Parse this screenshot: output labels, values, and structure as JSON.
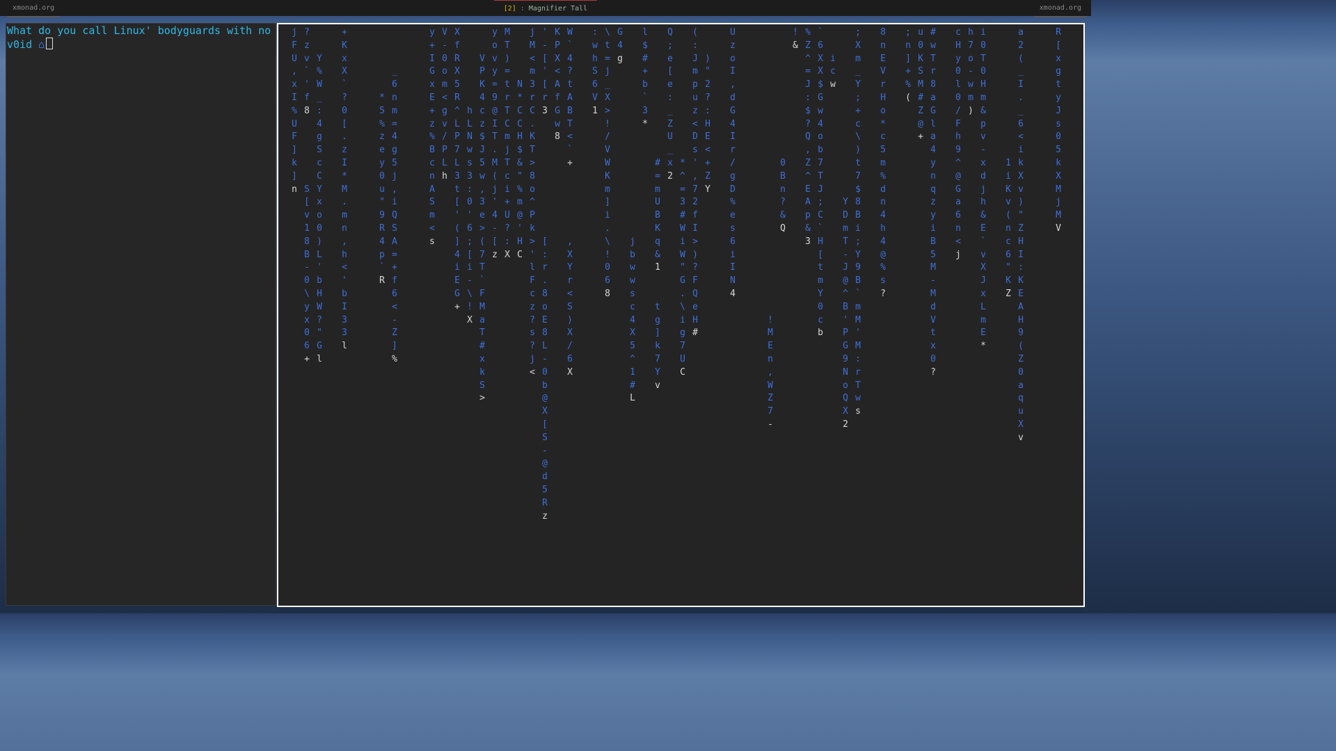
{
  "statusbar": {
    "left_title": "xmonad.org",
    "workspace": "[2]",
    "separator": " : ",
    "layout": "Magnifier Tall",
    "right_title": "xmonad.org"
  },
  "terminal": {
    "text": "What do you call Linux' bodyguards with no v0id ",
    "prompt_icon": "⌂"
  },
  "matrix": {
    "columns": [
      {
        "chars": "jFU,xI%UF]k]n"
      },
      {
        "chars": "?zv`'f8"
      },
      {
        "chars": "S[v18B-0\\yx06+"
      },
      {
        "chars": "Y%W_:4gScCYxo0)L'bHW?\"Gl"
      },
      {
        "chars": "+KxX`?0[.zI*M.mn,h<'bI33l"
      },
      {
        "chars": "_6nm=4g5j,iQSA=+f6<-Z]%"
      },
      {
        "chars": "*5%zey0u\"9R4p`R"
      },
      {
        "chars": "y+IGxE+z%BcnASm<s"
      },
      {
        "chars": "V-0om<gv/PLh"
      },
      {
        "chars": "XfRX5R^LP7L3t['(]4iEG+"
      },
      {
        "chars": "hLNws3:0'6;[i-\\!X"
      },
      {
        "chars": "VPK4cz$J5w,3e>(7T`FMaT#xkS>"
      },
      {
        "chars": "yovy=9@IT.M(j'4-[z"
      },
      {
        "chars": "MT)=trTCmjTci+U?:X"
      },
      {
        "chars": "N*CCH$&\"%m@'HC"
      },
      {
        "chars": "jM<m3rC.KT>8o^Pk>'lFcz?s?j<"
      },
      {
        "chars": "'-['[r3"
      },
      {
        "chars": "[:r.8oE8L-0b@X[S-@d5Rz"
      },
      {
        "chars": "KPX<AfGw8"
      },
      {
        "chars": "W`4?tABT<`+"
      },
      {
        "chars": ",XYr<S)X/6X"
      },
      {
        "chars": ":whS6V1"
      },
      {
        "chars": "\\t=j_X>!/VWKm]i.\\!068"
      },
      {
        "chars": "G4g"
      },
      {
        "chars": "jbwwsc4X5^1#L"
      },
      {
        "chars": "l$#+b`3*"
      },
      {
        "chars": "tg]k7Yv"
      },
      {
        "chars": "#=mUBKq&1"
      },
      {
        "chars": "Q;e[e:_ZU_x2"
      },
      {
        "chars": "*^=3#WiW\"G.\\ig7UC"
      },
      {
        "chars": "(:Jmpuz<Ds',72fI>)?FQeH#"
      },
      {
        "chars": ")\"2?:HE<+ZY"
      },
      {
        "chars": "UzoI,dG4Ir/gD%es6iIN4"
      },
      {
        "chars": "!MEn,WZ7-"
      },
      {
        "chars": "0Bn?&Q"
      },
      {
        "chars": "!&"
      },
      {
        "chars": "%Z^=J:$?Q,Z^EAp&3"
      },
      {
        "chars": "`6XX$Gw4ob7TJ;C`H[tmY0cb"
      },
      {
        "chars": "icw"
      },
      {
        "chars": "YDmT-J@^B'PG9NoQX2"
      },
      {
        "chars": ";Xm_Y;+c\\)t7$8Bi;Y9B`mM'M:rTws"
      },
      {
        "chars": "8nEVrHo*c5m%dn4h4@%s?"
      },
      {
        "chars": ";n]+%("
      },
      {
        "chars": "u0KSM#Z@+"
      },
      {
        "chars": "#wTr8aGla4ynqzyiB5M-MdVtx0?"
      },
      {
        "chars": "cHy0l0/Fh9^@Ga6n<j"
      },
      {
        "chars": "h7o-wm)"
      },
      {
        "chars": "i0T0Hm&pv-xdjh&E`vXJxLmE*"
      },
      {
        "chars": "1iKv(nc6\"KZ"
      },
      {
        "chars": "a2(_I._6<ikXv)\"ZHI:KEAH9(Z0aquXv"
      },
      {
        "chars": "R[xgtyJs05kXMjMV"
      }
    ]
  }
}
